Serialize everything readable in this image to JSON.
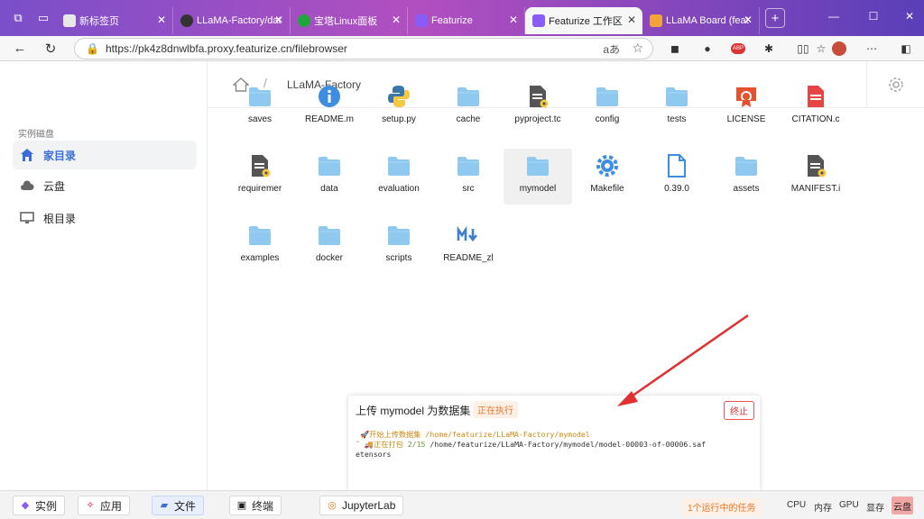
{
  "browser": {
    "tabs": [
      {
        "title": "新标签页",
        "color": "#e8e8e8",
        "active": false
      },
      {
        "title": "LLaMA-Factory/dat",
        "color": "#333333",
        "active": false
      },
      {
        "title": "宝塔Linux面板",
        "color": "#20a53a",
        "active": false
      },
      {
        "title": "Featurize",
        "color": "#8a5cf6",
        "active": false
      },
      {
        "title": "Featurize 工作区",
        "color": "#8a5cf6",
        "active": true
      },
      {
        "title": "LLaMA Board (feat",
        "color": "#f2a33a",
        "active": false
      }
    ],
    "url": "https://pk4z8dnwlbfa.proxy.featurize.cn/filebrowser",
    "ext_abp": "ABP"
  },
  "sidebar": {
    "section_title": "实例磁盘",
    "items": [
      {
        "label": "家目录",
        "active": true
      },
      {
        "label": "云盘",
        "active": false
      },
      {
        "label": "根目录",
        "active": false
      }
    ]
  },
  "breadcrumb": {
    "sep": "/",
    "current": "LLaMA-Factory"
  },
  "files": [
    {
      "name": "saves",
      "type": "folder"
    },
    {
      "name": "README.m",
      "type": "info"
    },
    {
      "name": "setup.py",
      "type": "python"
    },
    {
      "name": "cache",
      "type": "folder"
    },
    {
      "name": "pyproject.tc",
      "type": "doc-gear"
    },
    {
      "name": "config",
      "type": "folder"
    },
    {
      "name": "tests",
      "type": "folder"
    },
    {
      "name": "LICENSE",
      "type": "license"
    },
    {
      "name": "CITATION.c",
      "type": "pdf"
    },
    {
      "name": "requiremer",
      "type": "doc-gear"
    },
    {
      "name": "data",
      "type": "folder"
    },
    {
      "name": "evaluation",
      "type": "folder"
    },
    {
      "name": "src",
      "type": "folder"
    },
    {
      "name": "mymodel",
      "type": "folder"
    },
    {
      "name": "Makefile",
      "type": "gear"
    },
    {
      "name": "0.39.0",
      "type": "file"
    },
    {
      "name": "assets",
      "type": "folder"
    },
    {
      "name": "MANIFEST.i",
      "type": "doc-gear"
    },
    {
      "name": "examples",
      "type": "folder"
    },
    {
      "name": "docker",
      "type": "folder"
    },
    {
      "name": "scripts",
      "type": "folder"
    },
    {
      "name": "README_zl",
      "type": "markdown"
    }
  ],
  "selected_file": "mymodel",
  "task": {
    "title": "上传 mymodel 为数据集",
    "status": "正在执行",
    "stop": "终止",
    "log_line1_prefix": "开始上传数据集",
    "log_line1_path": "/home/featurize/LLaMA-Factory/mymodel",
    "log_line2_prefix": "正在打包",
    "log_line2_count": "2/15",
    "log_line2_path": "/home/featurize/LLaMA-Factory/mymodel/model-00003-of-00006.saf",
    "log_line3": "etensors"
  },
  "bottombar": {
    "buttons": [
      {
        "label": "实例"
      },
      {
        "label": "应用"
      },
      {
        "label": "文件"
      },
      {
        "label": "终端"
      },
      {
        "label": "JupyterLab"
      }
    ],
    "running_tasks": "1个运行中的任务",
    "stats": [
      "CPU",
      "内存",
      "GPU",
      "显存"
    ],
    "cloud": "云盘"
  },
  "colors": {
    "accent": "#3b6ed8",
    "folder": "#8fc9f0",
    "warning": "#e8792b",
    "danger": "#dd3333",
    "arrow": "#e03030"
  }
}
